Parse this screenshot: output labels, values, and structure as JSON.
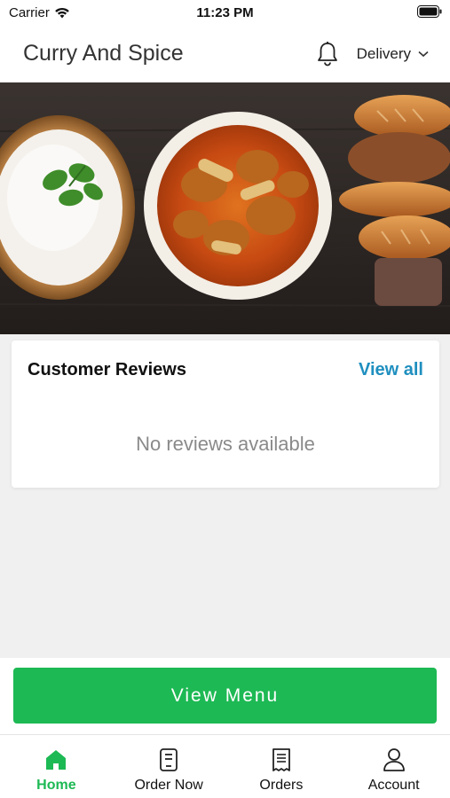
{
  "status_bar": {
    "carrier": "Carrier",
    "time": "11:23 PM"
  },
  "header": {
    "title": "Curry And Spice",
    "delivery_label": "Delivery"
  },
  "reviews": {
    "title": "Customer Reviews",
    "view_all_label": "View all",
    "empty_text": "No reviews available"
  },
  "view_menu_label": "View Menu",
  "tabs": [
    {
      "label": "Home",
      "icon": "home-icon",
      "active": true
    },
    {
      "label": "Order Now",
      "icon": "order-icon",
      "active": false
    },
    {
      "label": "Orders",
      "icon": "receipt-icon",
      "active": false
    },
    {
      "label": "Account",
      "icon": "user-icon",
      "active": false
    }
  ],
  "colors": {
    "accent": "#1db954",
    "link": "#1f8fbf",
    "background": "#f0f0f0"
  }
}
